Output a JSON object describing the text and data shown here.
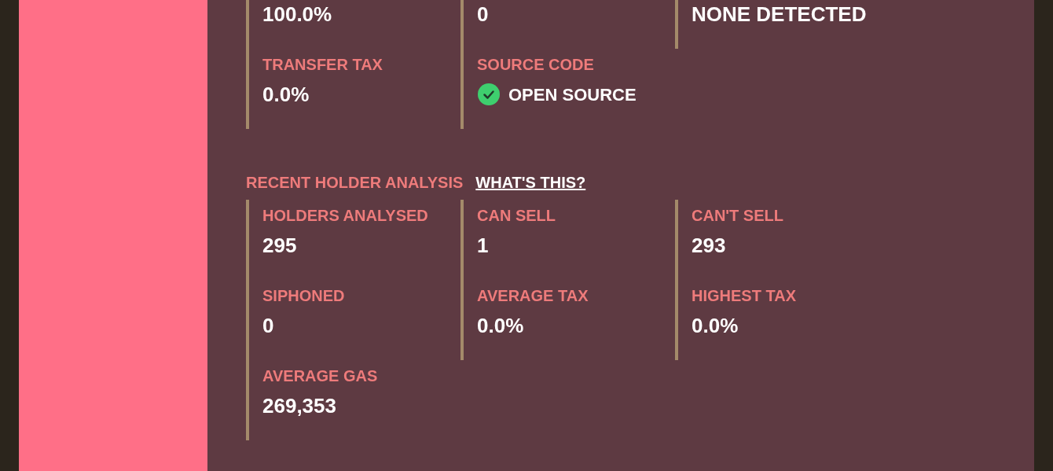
{
  "sections": [
    {
      "columns": [
        {
          "items": [
            {
              "value": "100.0%"
            },
            {
              "label": "TRANSFER TAX",
              "value": "0.0%"
            }
          ]
        },
        {
          "items": [
            {
              "value": "0"
            },
            {
              "label": "SOURCE CODE",
              "value": "OPEN SOURCE",
              "kind": "verified"
            }
          ]
        },
        {
          "items": [
            {
              "value": "NONE DETECTED"
            }
          ]
        }
      ]
    },
    {
      "title": "RECENT HOLDER ANALYSIS",
      "link": "WHAT'S THIS?",
      "columns": [
        {
          "items": [
            {
              "label": "HOLDERS ANALYSED",
              "value": "295"
            },
            {
              "label": "SIPHONED",
              "value": "0"
            },
            {
              "label": "AVERAGE GAS",
              "value": "269,353"
            }
          ]
        },
        {
          "items": [
            {
              "label": "CAN SELL",
              "value": "1"
            },
            {
              "label": "AVERAGE TAX",
              "value": "0.0%"
            }
          ]
        },
        {
          "items": [
            {
              "label": "CAN'T SELL",
              "value": "293"
            },
            {
              "label": "HIGHEST TAX",
              "value": "0.0%"
            }
          ]
        }
      ]
    }
  ]
}
